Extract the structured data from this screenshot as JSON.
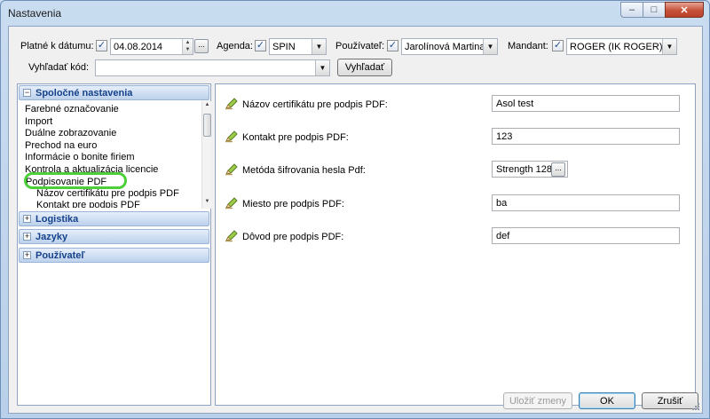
{
  "window": {
    "title": "Nastavenia"
  },
  "filters": {
    "date_label": "Platné k dátumu:",
    "date_value": "04.08.2014",
    "agenda_label": "Agenda:",
    "agenda_value": "SPIN",
    "user_label": "Používateľ:",
    "user_value": "Jarolínová Martina",
    "mandant_label": "Mandant:",
    "mandant_value": "ROGER (IK ROGER)",
    "search_label": "Vyhľadať kód:",
    "search_value": "",
    "search_button": "Vyhľadať"
  },
  "navigation": {
    "common_header": "Spoločné nastavenia",
    "common_items": [
      "Farebné označovanie",
      "Import",
      "Duálne zobrazovanie",
      "Prechod na euro",
      "Informácie o bonite firiem",
      "Kontrola a aktualizácia licencie",
      "Podpisovanie PDF"
    ],
    "common_subitems": [
      "Názov certifikátu pre podpis PDF",
      "Kontakt pre podpis PDF"
    ],
    "groups": [
      "Logistika",
      "Jazyky",
      "Používateľ"
    ]
  },
  "properties": [
    {
      "label": "Názov certifikátu pre podpis PDF:",
      "value": "Asol test"
    },
    {
      "label": "Kontakt pre podpis PDF:",
      "value": "123"
    },
    {
      "label": "Metóda šifrovania hesla Pdf:",
      "value": "Strength 128"
    },
    {
      "label": "Miesto pre podpis PDF:",
      "value": "ba"
    },
    {
      "label": "Dôvod pre podpis PDF:",
      "value": "def"
    }
  ],
  "footer": {
    "save_label": "Uložiť zmeny",
    "ok_label": "OK",
    "cancel_label": "Zrušiť"
  },
  "colors": {
    "highlight_ring": "#4cd03a",
    "nav_header_text": "#15428b"
  }
}
